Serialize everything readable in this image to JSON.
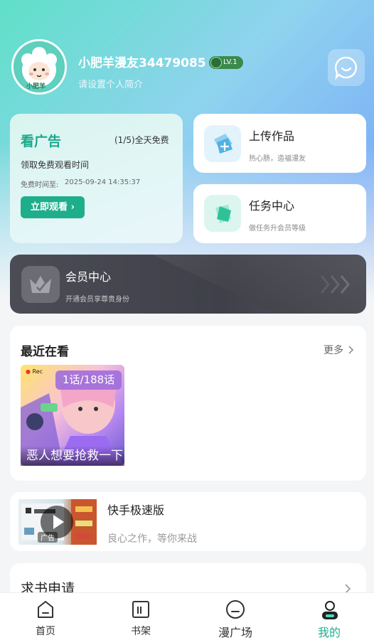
{
  "profile": {
    "nickname": "小肥羊漫友34479085",
    "level": "LV.1",
    "bio_placeholder": "请设置个人简介",
    "avatar_text": "小肥羊"
  },
  "ad_card": {
    "title": "看广告",
    "count": "(1/5)全天免费",
    "desc": "领取免费观看时间",
    "free_time_label": "免费时间至:",
    "free_time_value": "2025-09-24 14:35:37",
    "watch_button": "立即观看"
  },
  "upload_card": {
    "title": "上传作品",
    "subtitle": "热心肠，造福漫友"
  },
  "task_card": {
    "title": "任务中心",
    "subtitle": "做任务升会员等级"
  },
  "vip_card": {
    "title": "会员中心",
    "subtitle": "开通会员享尊贵身份"
  },
  "recent": {
    "title": "最近在看",
    "more": "更多",
    "items": [
      {
        "progress": "1话/188话",
        "title": "恶人想要抢救一下",
        "rec_tag": "Rec"
      }
    ]
  },
  "app_ad": {
    "name": "快手极速版",
    "slogan": "良心之作，等你来战",
    "ad_tag": "广告"
  },
  "request": {
    "title": "求书申请"
  },
  "tabbar": {
    "active_color": "#1fae8c",
    "tabs": [
      {
        "label": "首页",
        "icon": "home-icon"
      },
      {
        "label": "书架",
        "icon": "bookshelf-icon"
      },
      {
        "label": "漫广场",
        "icon": "plaza-icon"
      },
      {
        "label": "我的",
        "icon": "profile-icon",
        "active": true
      }
    ]
  },
  "colors": {
    "accent": "#1fae8c",
    "vip_bg": "#45464f"
  }
}
